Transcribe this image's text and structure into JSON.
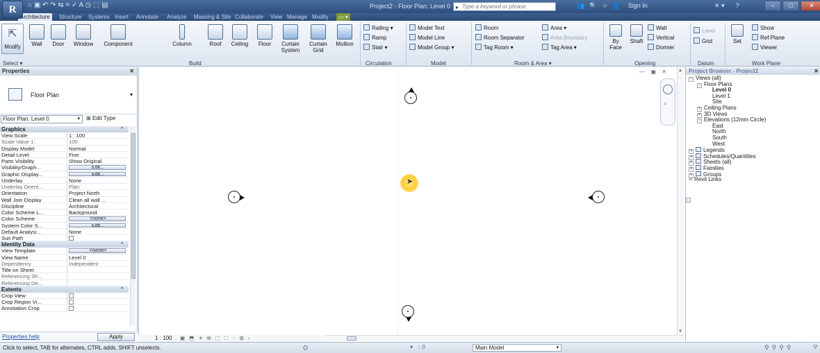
{
  "app": {
    "logo_text": "R",
    "window_title": "Project2 - Floor Plan: Level 0",
    "quick_access": "⌂ ▣ ↶ ↷ ⇆ ⌗ ✓ A ◷ ⬚ ▤",
    "search_placeholder": "Type a keyword or phrase",
    "sign_in": "Sign In",
    "title_icons": [
      "👥",
      "🔍",
      "☆",
      "👤"
    ],
    "help": "?",
    "window_controls": [
      "–",
      "□",
      "✕"
    ]
  },
  "ribbon_tabs": [
    {
      "label": "Architecture",
      "active": true
    },
    {
      "label": "Structure"
    },
    {
      "label": "Systems"
    },
    {
      "label": "Insert"
    },
    {
      "label": "Annotate"
    },
    {
      "label": "Analyze"
    },
    {
      "label": "Massing & Site"
    },
    {
      "label": "Collaborate"
    },
    {
      "label": "View"
    },
    {
      "label": "Manage"
    },
    {
      "label": "Modify"
    },
    {
      "label": "▭ ▾",
      "mod": true
    }
  ],
  "ribbon": {
    "modify_label": "Modify",
    "build_buttons": [
      "Wall",
      "Door",
      "Window",
      "Component",
      "Column",
      "Roof",
      "Ceiling",
      "Floor",
      "Curtain System",
      "Curtain Grid",
      "Mullion"
    ],
    "circulation": [
      "Railing ▾",
      "Ramp",
      "Stair ▾"
    ],
    "model": [
      "Model Text",
      "Model Line",
      "Model Group ▾"
    ],
    "room_area": [
      "Room",
      "Room Separator",
      "Tag Room ▾",
      "Area ▾",
      "Area Boundary",
      "Tag Area ▾"
    ],
    "opening_big": [
      "By Face",
      "Shaft"
    ],
    "opening_small": [
      "Wall",
      "Vertical",
      "Dormer"
    ],
    "datum": [
      "Level",
      "Grid"
    ],
    "work_plane_big": "Set",
    "work_plane": [
      "Show",
      "Ref Plane",
      "Viewer"
    ],
    "panel_labels": [
      "Select ▾",
      "Build",
      "Circulation",
      "Model",
      "Room & Area ▾",
      "Opening",
      "Datum",
      "Work Plane"
    ]
  },
  "properties": {
    "header": "Properties",
    "type_name": "Floor Plan",
    "instance": "Floor Plan: Level 0",
    "edit_type": "Edit Type",
    "groups": [
      {
        "name": "Graphics",
        "rows": [
          {
            "k": "View Scale",
            "v": "1 : 100"
          },
          {
            "k": "Scale Value    1:",
            "v": "100",
            "dim": true
          },
          {
            "k": "Display Model",
            "v": "Normal"
          },
          {
            "k": "Detail Level",
            "v": "Fine"
          },
          {
            "k": "Parts Visibility",
            "v": "Show Original"
          },
          {
            "k": "Visibility/Graph...",
            "v": "Edit...",
            "btn": true
          },
          {
            "k": "Graphic Display...",
            "v": "Edit...",
            "btn": true
          },
          {
            "k": "Underlay",
            "v": "None"
          },
          {
            "k": "Underlay Orient...",
            "v": "Plan",
            "dim": true
          },
          {
            "k": "Orientation",
            "v": "Project North"
          },
          {
            "k": "Wall Join Display",
            "v": "Clean all wall ..."
          },
          {
            "k": "Discipline",
            "v": "Architectural"
          },
          {
            "k": "Color Scheme L...",
            "v": "Background"
          },
          {
            "k": "Color Scheme",
            "v": "<none>",
            "btn": true
          },
          {
            "k": "System Color S...",
            "v": "Edit...",
            "btn": true
          },
          {
            "k": "Default Analysi...",
            "v": "None"
          },
          {
            "k": "Sun Path",
            "v": "",
            "check": true
          }
        ]
      },
      {
        "name": "Identity Data",
        "rows": [
          {
            "k": "View Template",
            "v": "<None>",
            "btn": true
          },
          {
            "k": "View Name",
            "v": "Level 0"
          },
          {
            "k": "Dependency",
            "v": "Independent",
            "dim": true
          },
          {
            "k": "Title on Sheet",
            "v": ""
          },
          {
            "k": "Referencing Sh...",
            "v": "",
            "dim": true
          },
          {
            "k": "Referencing De...",
            "v": "",
            "dim": true
          }
        ]
      },
      {
        "name": "Extents",
        "rows": [
          {
            "k": "Crop View",
            "v": "",
            "check": true
          },
          {
            "k": "Crop Region Vi...",
            "v": "",
            "check": true
          },
          {
            "k": "Annotation Crop",
            "v": "",
            "check": true
          }
        ]
      }
    ],
    "help_link": "Properties help",
    "apply": "Apply"
  },
  "browser": {
    "header": "Project Browser - Project2",
    "nodes": [
      {
        "label": "Views (all)",
        "pm": "-",
        "depth": 0
      },
      {
        "label": "Floor Plans",
        "pm": "-",
        "depth": 1
      },
      {
        "label": "Level 0",
        "depth": 2,
        "bold": true
      },
      {
        "label": "Level 1",
        "depth": 2
      },
      {
        "label": "Site",
        "depth": 2
      },
      {
        "label": "Ceiling Plans",
        "pm": "+",
        "depth": 1
      },
      {
        "label": "3D Views",
        "pm": "+",
        "depth": 1
      },
      {
        "label": "Elevations (12mm Circle)",
        "pm": "-",
        "depth": 1
      },
      {
        "label": "East",
        "depth": 2
      },
      {
        "label": "North",
        "depth": 2
      },
      {
        "label": "South",
        "depth": 2
      },
      {
        "label": "West",
        "depth": 2
      },
      {
        "label": "Legends",
        "pm": "+",
        "depth": 0,
        "icon": true
      },
      {
        "label": "Schedules/Quantities",
        "pm": "+",
        "depth": 0,
        "icon": true
      },
      {
        "label": "Sheets (all)",
        "pm": "+",
        "depth": 0,
        "icon": true
      },
      {
        "label": "Families",
        "pm": "+",
        "depth": 0,
        "icon": true
      },
      {
        "label": "Groups",
        "pm": "+",
        "depth": 0,
        "icon": true
      },
      {
        "label": "Revit Links",
        "depth": 0,
        "link": true
      }
    ]
  },
  "viewbar": {
    "scale": "1 : 100",
    "icons": "▣ ⬒ ☀ ⧉ ⬚ ⛶ ◌ ⊞ ‹"
  },
  "status": {
    "message": "Click to select, TAB for alternates, CTRL adds, SHIFT unselects.",
    "main_model": "Main Model",
    "zero": ":0"
  }
}
